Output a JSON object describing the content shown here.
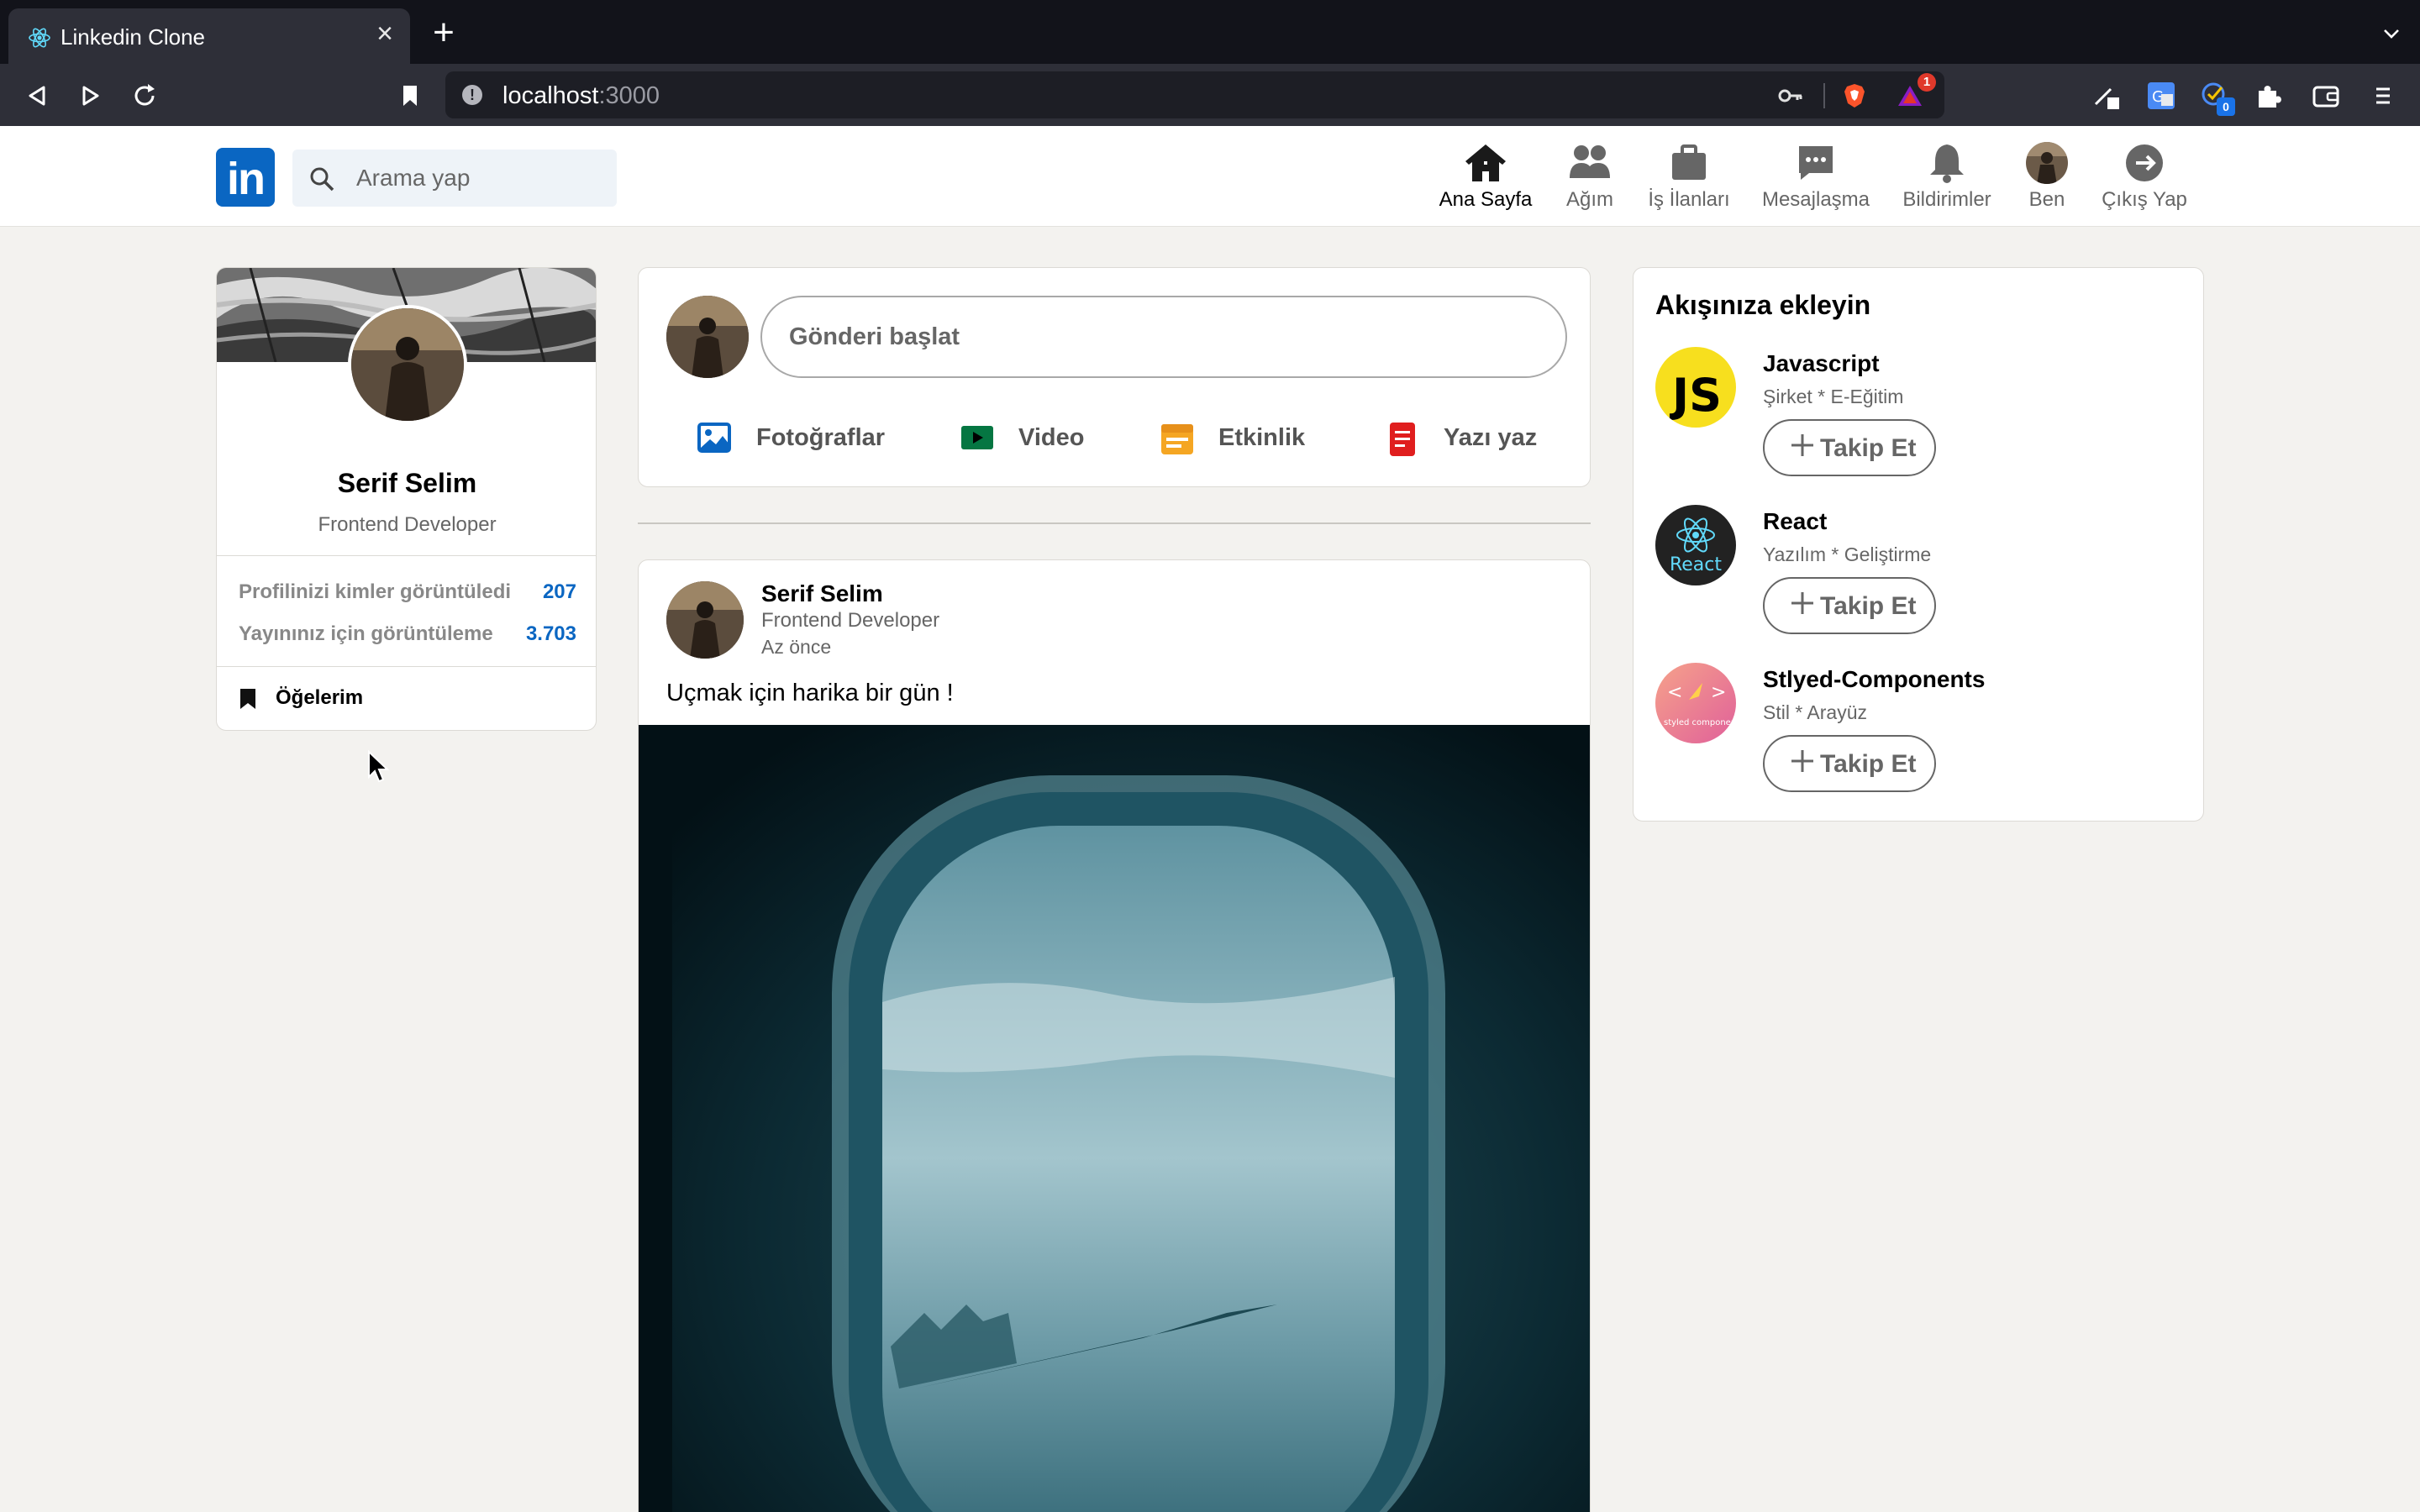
{
  "browser": {
    "tab_title": "Linkedin Clone",
    "url_host": "localhost",
    "url_port": ":3000",
    "new_tab_label": "+",
    "close_label": "×",
    "extension_badge": "1",
    "pip_badge": "0"
  },
  "header": {
    "logo": "in",
    "search_placeholder": "Arama yap",
    "nav": [
      {
        "label": "Ana Sayfa",
        "icon": "home-icon",
        "active": true
      },
      {
        "label": "Ağım",
        "icon": "people-icon"
      },
      {
        "label": "İş İlanları",
        "icon": "briefcase-icon"
      },
      {
        "label": "Mesajlaşma",
        "icon": "message-icon"
      },
      {
        "label": "Bildirimler",
        "icon": "bell-icon"
      },
      {
        "label": "Ben",
        "icon": "avatar"
      },
      {
        "label": "Çıkış Yap",
        "icon": "logout-icon"
      }
    ]
  },
  "profile": {
    "name": "Serif Selim",
    "title": "Frontend Developer",
    "stats": [
      {
        "label": "Profilinizi kimler görüntüledi",
        "value": "207"
      },
      {
        "label": "Yayınınız için görüntüleme",
        "value": "3.703"
      }
    ],
    "items_label": "Öğelerim"
  },
  "share": {
    "placeholder": "Gönderi başlat",
    "actions": [
      {
        "label": "Fotoğraflar",
        "icon": "photo-icon",
        "color": "#0a66c2"
      },
      {
        "label": "Video",
        "icon": "video-icon",
        "color": "#057642"
      },
      {
        "label": "Etkinlik",
        "icon": "event-icon",
        "color": "#f5a623"
      },
      {
        "label": "Yazı yaz",
        "icon": "article-icon",
        "color": "#e01e1e"
      }
    ]
  },
  "post": {
    "author": "Serif Selim",
    "author_title": "Frontend Developer",
    "time": "Az önce",
    "text": "Uçmak için harika bir gün !"
  },
  "follow": {
    "heading": "Akışınıza ekleyin",
    "button_label": "Takip Et",
    "items": [
      {
        "name": "Javascript",
        "sub": "Şirket * E-Eğitim",
        "logo_text": "JS"
      },
      {
        "name": "React",
        "sub": "Yazılım * Geliştirme",
        "logo_text": "React"
      },
      {
        "name": "Stlyed-Components",
        "sub": "Stil * Arayüz",
        "logo_text": "styled components"
      }
    ]
  },
  "colors": {
    "brand": "#0a66c2",
    "background": "#f3f2ef"
  }
}
